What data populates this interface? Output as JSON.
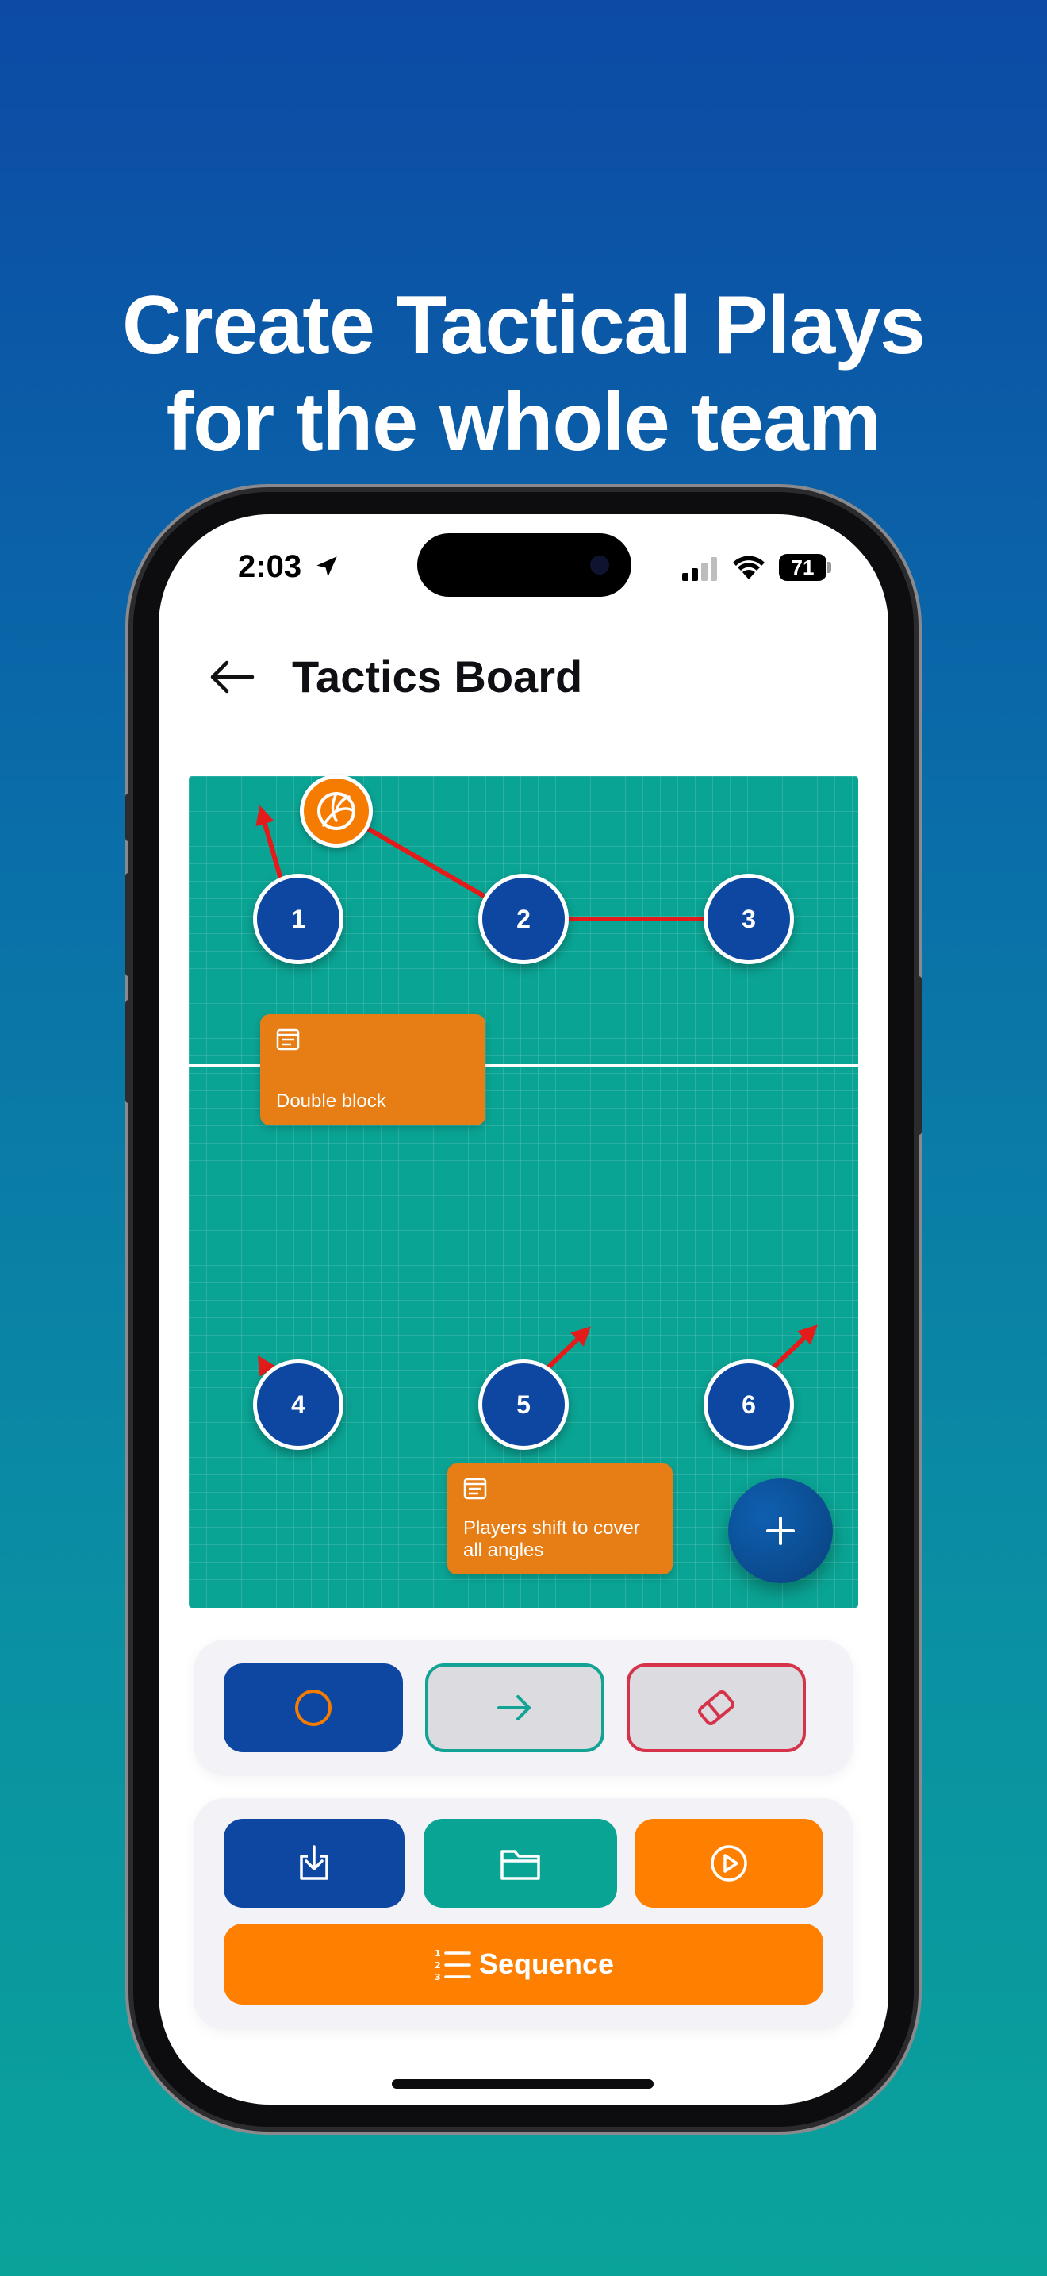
{
  "promo": {
    "headline_line1": "Create Tactical Plays",
    "headline_line2": "for the whole team"
  },
  "status_bar": {
    "time": "2:03",
    "battery": "71"
  },
  "header": {
    "title": "Tactics Board",
    "back_icon": "arrow-left-icon"
  },
  "board": {
    "court_color": "#0aa494",
    "player_color": "#0d47a1",
    "arrow_color": "#e31b1b",
    "players": [
      {
        "number": "1"
      },
      {
        "number": "2"
      },
      {
        "number": "3"
      },
      {
        "number": "4"
      },
      {
        "number": "5"
      },
      {
        "number": "6"
      }
    ],
    "notes": [
      {
        "text": "Double block"
      },
      {
        "text": "Players shift to cover all angles"
      }
    ],
    "ball_icon": "volleyball-icon",
    "fab_icon": "plus-icon"
  },
  "tools": [
    {
      "name": "circle-tool",
      "icon": "circle-icon",
      "color": "#0d47a1"
    },
    {
      "name": "arrow-tool",
      "icon": "arrow-right-icon",
      "color": "#12a394"
    },
    {
      "name": "eraser-tool",
      "icon": "eraser-icon",
      "color": "#d6334a"
    }
  ],
  "actions": [
    {
      "name": "save",
      "icon": "download-icon",
      "color": "#0d47a1"
    },
    {
      "name": "open",
      "icon": "folder-icon",
      "color": "#0aa494"
    },
    {
      "name": "play",
      "icon": "play-circle-icon",
      "color": "#ff7f00"
    }
  ],
  "sequence_button": {
    "label": "Sequence",
    "icon": "numbered-list-icon"
  }
}
